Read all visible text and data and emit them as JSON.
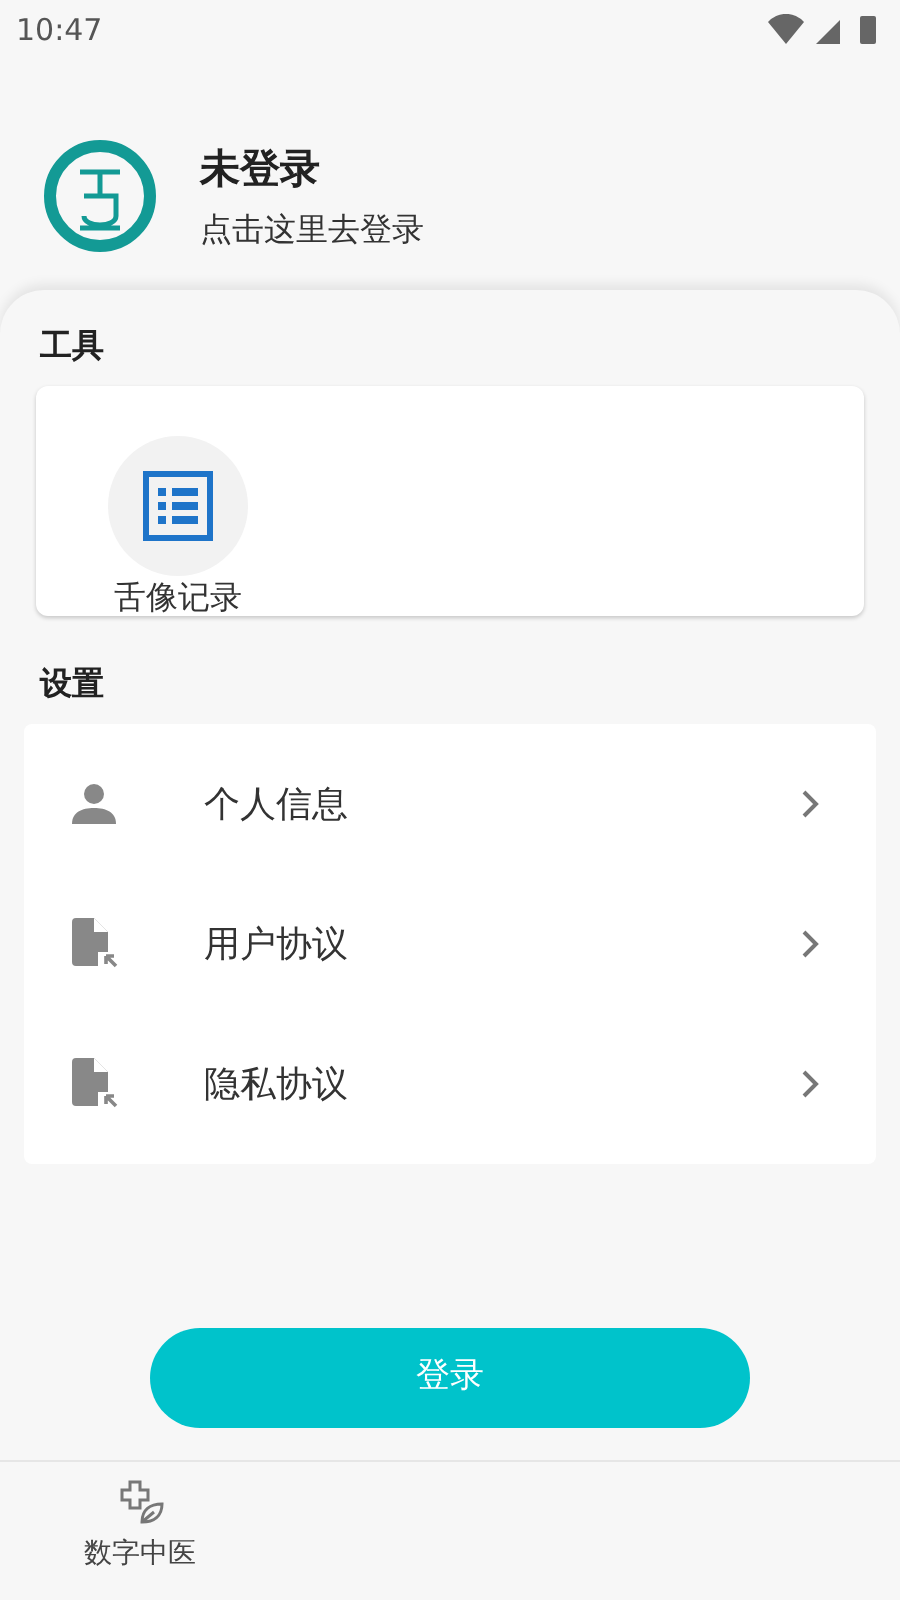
{
  "status_bar": {
    "time": "10:47"
  },
  "profile": {
    "title": "未登录",
    "subtitle": "点击这里去登录"
  },
  "tools": {
    "heading": "工具",
    "items": [
      {
        "label": "舌像记录"
      }
    ]
  },
  "settings": {
    "heading": "设置",
    "items": [
      {
        "kind": "person",
        "label": "个人信息"
      },
      {
        "kind": "document",
        "label": "用户协议"
      },
      {
        "kind": "document",
        "label": "隐私协议"
      }
    ]
  },
  "login_button": "登录",
  "bottom_nav": [
    {
      "label": "数字中医",
      "selected": false
    }
  ]
}
